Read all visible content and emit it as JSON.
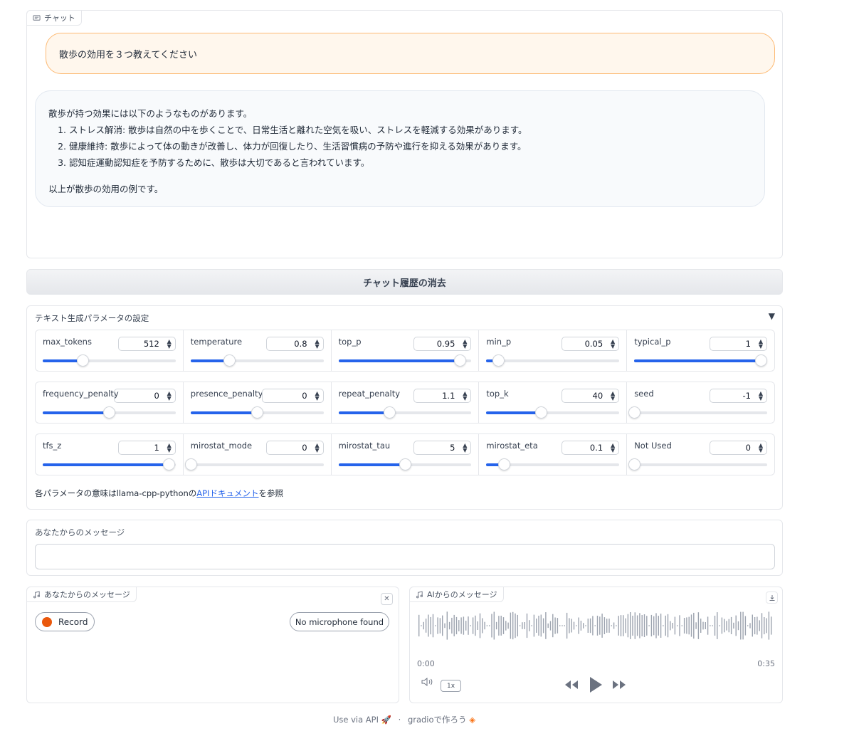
{
  "chatbot": {
    "label": "チャット",
    "user_message": "散歩の効用を３つ教えてください",
    "bot_intro": "散歩が持つ効果には以下のようなものがあります。",
    "bot_items": [
      "ストレス解消: 散歩は自然の中を歩くことで、日常生活と離れた空気を吸い、ストレスを軽減する効果があります。",
      "健康維持: 散歩によって体の動きが改善し、体力が回復したり、生活習慣病の予防や進行を抑える効果があります。",
      "認知症運動認知症を予防するために、散歩は大切であると言われています。"
    ],
    "bot_outro": "以上が散歩の効用の例です。"
  },
  "clear_button": "チャット履歴の消去",
  "params": {
    "title": "テキスト生成パラメータの設定",
    "toggle": "▼",
    "rows": [
      [
        {
          "name": "max_tokens",
          "value": "512",
          "level": 0.3
        },
        {
          "name": "temperature",
          "value": "0.8",
          "level": 0.29
        },
        {
          "name": "top_p",
          "value": "0.95",
          "level": 0.91
        },
        {
          "name": "min_p",
          "value": "0.05",
          "level": 0.09
        },
        {
          "name": "typical_p",
          "value": "1",
          "level": 0.95
        }
      ],
      [
        {
          "name": "frequency_penalty",
          "value": "0",
          "level": 0.5
        },
        {
          "name": "presence_penalty",
          "value": "0",
          "level": 0.5
        },
        {
          "name": "repeat_penalty",
          "value": "1.1",
          "level": 0.38
        },
        {
          "name": "top_k",
          "value": "40",
          "level": 0.41
        },
        {
          "name": "seed",
          "value": "-1",
          "level": 0.0
        }
      ],
      [
        {
          "name": "tfs_z",
          "value": "1",
          "level": 0.95
        },
        {
          "name": "mirostat_mode",
          "value": "0",
          "level": 0.0
        },
        {
          "name": "mirostat_tau",
          "value": "5",
          "level": 0.5
        },
        {
          "name": "mirostat_eta",
          "value": "0.1",
          "level": 0.13
        },
        {
          "name": "Not Used",
          "value": "0",
          "level": 0.0
        }
      ]
    ],
    "note_prefix": "各パラメータの意味はllama-cpp-pythonの",
    "note_link": "APIドキュメント",
    "note_suffix": "を参照"
  },
  "message_input": {
    "label": "あなたからのメッセージ",
    "value": ""
  },
  "audio_input": {
    "label": "あなたからのメッセージ",
    "record_button": "Record",
    "mic_status": "No microphone found"
  },
  "audio_output": {
    "label": "AIからのメッセージ",
    "current_time": "0:00",
    "duration": "0:35",
    "speed": "1x"
  },
  "footer": {
    "api_text": "Use via API",
    "separator": "·",
    "built_with": "gradioで作ろう"
  },
  "colors": {
    "accent": "#2563eb",
    "user_bubble": "#fff7ed",
    "record_dot": "#ea580c"
  }
}
